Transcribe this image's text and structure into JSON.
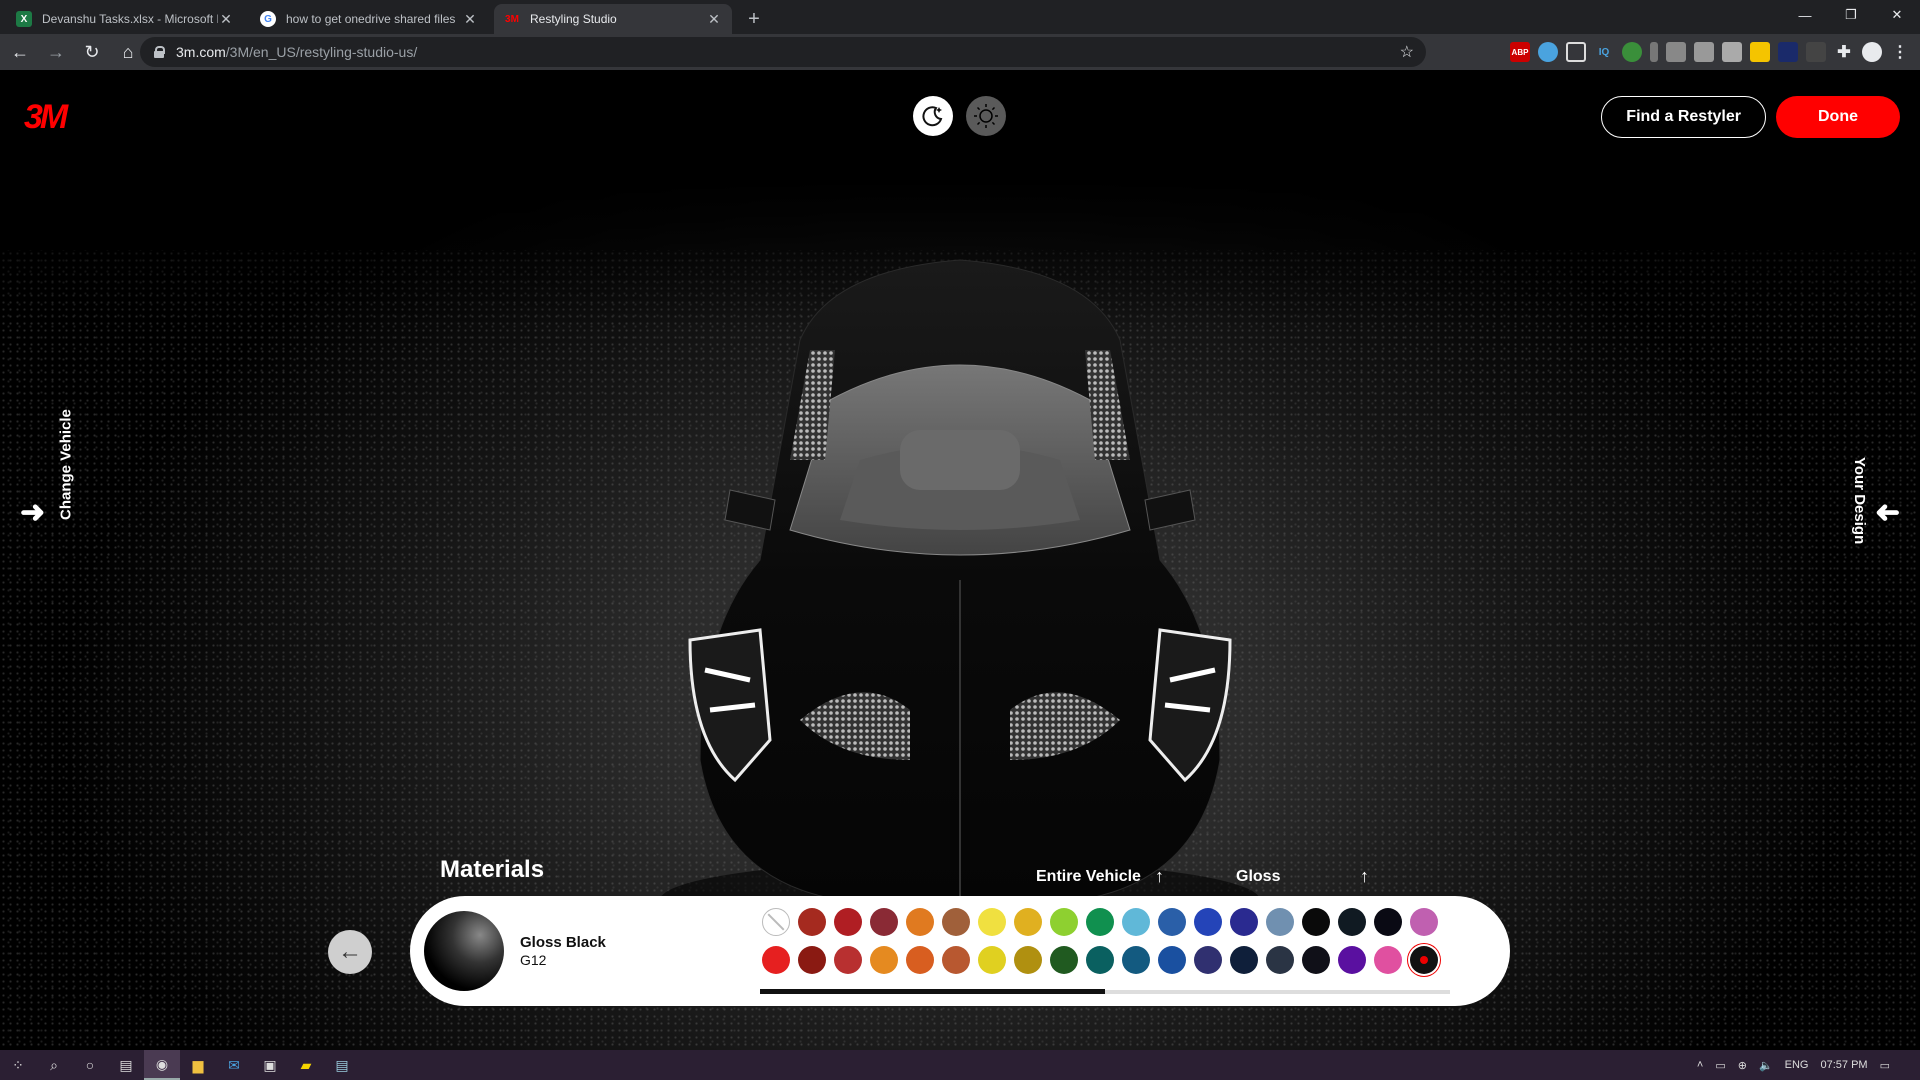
{
  "browser": {
    "tabs": [
      {
        "label": "Devanshu Tasks.xlsx - Microsoft E",
        "icon": "excel-icon",
        "active": false
      },
      {
        "label": "how to get onedrive shared files",
        "icon": "google-icon",
        "active": false
      },
      {
        "label": "Restyling Studio",
        "icon": "3m-icon",
        "active": true
      }
    ],
    "new_tab": "+",
    "url_host": "3m.com",
    "url_path": "/3M/en_US/restyling-studio-us/",
    "extensions": [
      "ABP",
      "",
      "",
      "IQ",
      "",
      "",
      "",
      "",
      "",
      "",
      "",
      "",
      "",
      ""
    ]
  },
  "app": {
    "logo": "3M",
    "find_restyler": "Find a Restyler",
    "done": "Done",
    "change_vehicle": "Change Vehicle",
    "your_design": "Your Design",
    "materials_title": "Materials",
    "filter_scope": "Entire Vehicle",
    "filter_finish": "Gloss",
    "selected_material": {
      "name": "Gloss Black",
      "code": "G12"
    },
    "swatches_row1": [
      "none",
      "#a52a1f",
      "#b01e23",
      "#8a2a35",
      "#e07a20",
      "#a0603a",
      "#f0e040",
      "#e0b020",
      "#8ed030",
      "#10904f",
      "#60b8d8",
      "#2a5fa8",
      "#2444b8",
      "#2a2a90",
      "#7090b0",
      "#0a0a0a",
      "#101a22",
      "#0a0a14",
      "#c060b0"
    ],
    "swatches_row2": [
      "#e62020",
      "#8a1a12",
      "#b83030",
      "#e58a20",
      "#d85e20",
      "#b85830",
      "#e0d020",
      "#b09010",
      "#205a20",
      "#0a6060",
      "#135a80",
      "#1a50a0",
      "#303070",
      "#0f1f3a",
      "#2a3444",
      "#101018",
      "#5a10a0",
      "#e050a0",
      "selected"
    ]
  },
  "taskbar": {
    "lang": "ENG",
    "time": "07:57 PM"
  }
}
